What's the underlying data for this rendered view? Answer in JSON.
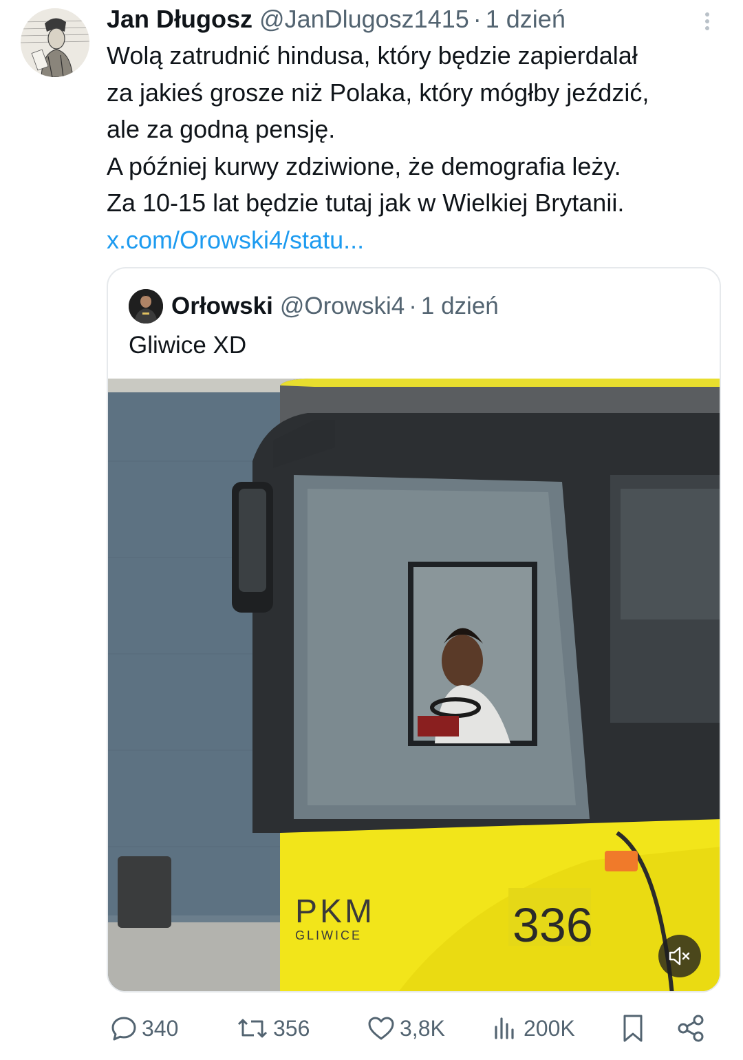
{
  "tweet": {
    "author_name": "Jan Długosz",
    "author_handle": "@JanDlugosz1415",
    "separator": "·",
    "time": "1 dzień",
    "text_lines": [
      "Wolą zatrudnić hindusa, który będzie zapierdalał",
      "za jakieś grosze niż Polaka, który mógłby jeździć,",
      "ale za godną pensję.",
      "A później kurwy zdziwione, że demografia leży.",
      "Za 10-15 lat będzie tutaj jak w Wielkiej Brytanii."
    ],
    "link_text": "x.com/Orowski4/statu...",
    "avatar_icon": "portrait-engraving-avatar",
    "more_icon": "vertical-ellipsis-icon"
  },
  "quoted": {
    "author_name": "Orłowski",
    "author_handle": "@Orowski4",
    "separator": "·",
    "time": "1 dzień",
    "text": "Gliwice XD",
    "media": {
      "bus_brand": "PKM",
      "bus_city": "GLIWICE",
      "bus_number": "336",
      "mute_icon": "speaker-muted-icon"
    }
  },
  "actions": {
    "replies": "340",
    "reposts": "356",
    "likes": "3,8K",
    "views": "200K",
    "icons": [
      "reply-icon",
      "repost-icon",
      "like-icon",
      "views-icon",
      "bookmark-icon",
      "share-icon"
    ]
  },
  "colors": {
    "text": "#0f1419",
    "secondary": "#536471",
    "link": "#1d9bf0",
    "bus_yellow": "#f2e51a"
  }
}
